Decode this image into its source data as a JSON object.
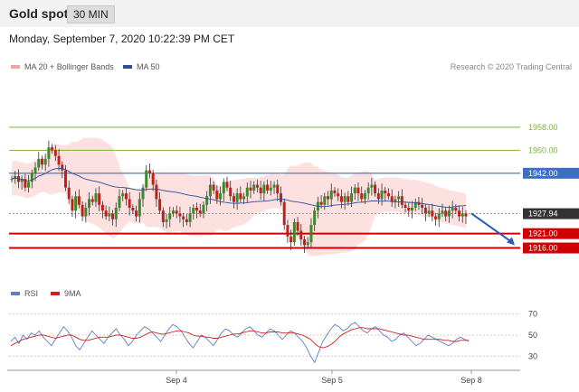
{
  "header": {
    "title": "Gold spot",
    "timeframe": "30 MIN"
  },
  "date_line": "Monday, September 7, 2020 10:22:39 PM CET",
  "legend": {
    "bb": {
      "label": "MA 20 + Bollinger Bands",
      "color": "#f4a3a3"
    },
    "ma50": {
      "label": "MA 50",
      "color": "#2b4d9c"
    },
    "rsi": {
      "label": "RSI",
      "color": "#5b7fc4"
    },
    "ma9": {
      "label": "9MA",
      "color": "#d02020"
    }
  },
  "credit": "Research © 2020 Trading Central",
  "colors": {
    "up": "#3a8a2a",
    "down": "#c0201a",
    "resistance": "#7fb33a",
    "pivot": "#3c6fc4",
    "support": "#d00000",
    "current": "#333333",
    "arrow": "#2b5bb0"
  },
  "chart_data": [
    {
      "type": "candlestick",
      "ylim": [
        1908,
        1974
      ],
      "x_ticks": [
        "Sep 4",
        "Sep 5",
        "Sep 8"
      ],
      "levels": [
        {
          "name": "resistance",
          "value": 1958.0,
          "label": "1958.00"
        },
        {
          "name": "resistance",
          "value": 1950.0,
          "label": "1950.00"
        },
        {
          "name": "pivot",
          "value": 1942.0,
          "label": "1942.00"
        },
        {
          "name": "current",
          "value": 1927.94,
          "label": "1927.94"
        },
        {
          "name": "support",
          "value": 1921.0,
          "label": "1921.00"
        },
        {
          "name": "support",
          "value": 1916.0,
          "label": "1916.00"
        }
      ],
      "forecast": {
        "from": 1928,
        "to": 1916
      },
      "closes": [
        1940,
        1941,
        1939,
        1940,
        1937,
        1939,
        1942,
        1944,
        1947,
        1945,
        1947,
        1951,
        1950,
        1948,
        1945,
        1943,
        1937,
        1933,
        1929,
        1934,
        1931,
        1927,
        1930,
        1933,
        1932,
        1935,
        1931,
        1929,
        1927,
        1928,
        1926,
        1930,
        1934,
        1935,
        1933,
        1930,
        1929,
        1927,
        1933,
        1937,
        1943,
        1942,
        1938,
        1933,
        1929,
        1925,
        1926,
        1928,
        1929,
        1928,
        1927,
        1926,
        1925,
        1928,
        1930,
        1929,
        1928,
        1931,
        1934,
        1938,
        1936,
        1933,
        1935,
        1939,
        1937,
        1934,
        1932,
        1935,
        1933,
        1934,
        1937,
        1936,
        1938,
        1937,
        1935,
        1938,
        1936,
        1937,
        1938,
        1935,
        1932,
        1924,
        1920,
        1918,
        1925,
        1922,
        1919,
        1917,
        1918,
        1924,
        1929,
        1932,
        1931,
        1934,
        1933,
        1936,
        1935,
        1934,
        1932,
        1934,
        1932,
        1935,
        1937,
        1935,
        1933,
        1935,
        1937,
        1938,
        1935,
        1933,
        1936,
        1935,
        1934,
        1932,
        1933,
        1934,
        1931,
        1930,
        1929,
        1930,
        1932,
        1931,
        1930,
        1928,
        1929,
        1927,
        1926,
        1928,
        1929,
        1927,
        1929,
        1930,
        1929,
        1927,
        1928,
        1927
      ]
    },
    {
      "type": "line",
      "ylim": [
        20,
        80
      ],
      "y_ticks": [
        70,
        50,
        30
      ],
      "x_ticks": [
        "Sep 4",
        "Sep 5",
        "Sep 8"
      ],
      "series": [
        {
          "name": "RSI",
          "values": [
            44,
            48,
            42,
            50,
            46,
            52,
            50,
            54,
            48,
            44,
            40,
            46,
            52,
            58,
            54,
            48,
            40,
            36,
            42,
            48,
            54,
            50,
            46,
            42,
            48,
            52,
            56,
            50,
            46,
            40,
            44,
            50,
            54,
            58,
            56,
            52,
            48,
            44,
            50,
            56,
            60,
            58,
            54,
            48,
            42,
            38,
            44,
            50,
            48,
            44,
            40,
            46,
            52,
            56,
            54,
            50,
            48,
            52,
            56,
            58,
            54,
            50,
            48,
            52,
            56,
            54,
            50,
            46,
            50,
            54,
            52,
            48,
            44,
            38,
            30,
            24,
            34,
            44,
            50,
            56,
            60,
            58,
            54,
            56,
            60,
            62,
            58,
            54,
            52,
            56,
            58,
            54,
            50,
            48,
            44,
            46,
            50,
            52,
            48,
            44,
            40,
            42,
            46,
            50,
            48,
            46,
            44,
            42,
            40,
            42,
            46,
            48,
            46,
            44
          ]
        },
        {
          "name": "9MA",
          "values": [
            40,
            42,
            44,
            46,
            47,
            48,
            49,
            50,
            50,
            49,
            48,
            47,
            48,
            49,
            50,
            50,
            48,
            46,
            45,
            45,
            46,
            47,
            48,
            48,
            48,
            49,
            50,
            50,
            49,
            48,
            47,
            47,
            48,
            50,
            52,
            53,
            52,
            51,
            51,
            52,
            53,
            54,
            54,
            53,
            52,
            50,
            49,
            49,
            48,
            48,
            47,
            47,
            48,
            49,
            50,
            51,
            51,
            52,
            53,
            54,
            54,
            53,
            52,
            52,
            53,
            53,
            53,
            52,
            52,
            52,
            52,
            51,
            50,
            48,
            46,
            42,
            39,
            38,
            39,
            41,
            44,
            48,
            51,
            53,
            55,
            56,
            57,
            57,
            56,
            56,
            56,
            56,
            55,
            54,
            53,
            52,
            51,
            50,
            50,
            49,
            48,
            47,
            46,
            46,
            46,
            46,
            46,
            45,
            45,
            44,
            44,
            45,
            45,
            45
          ]
        }
      ]
    }
  ]
}
